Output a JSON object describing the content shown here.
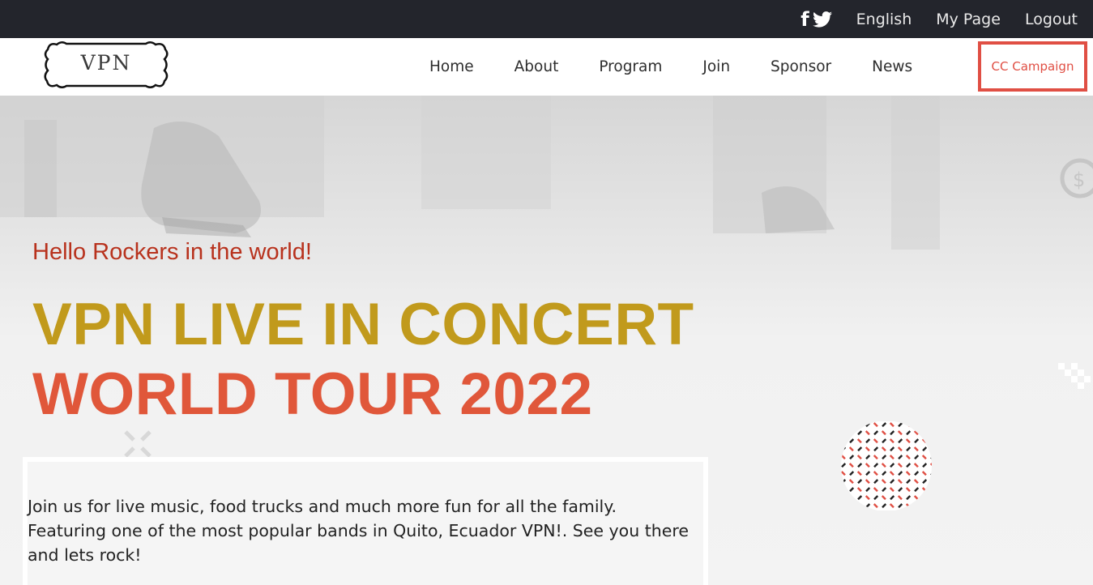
{
  "topbar": {
    "social": {
      "facebook_icon": "f",
      "twitter_icon": "twitter-bird"
    },
    "links": [
      "English",
      "My Page",
      "Logout"
    ]
  },
  "navbar": {
    "logo_text": "VPN",
    "items": [
      "Home",
      "About",
      "Program",
      "Join",
      "Sponsor",
      "News"
    ],
    "campaign_label": "CC Campaign"
  },
  "hero": {
    "greeting": "Hello Rockers in the world!",
    "title_line1": "VPN LIVE IN CONCERT",
    "title_line2": "WORLD TOUR 2022",
    "description": "Join us for live music, food trucks and much more fun for all the family. Featuring one of the most popular bands in Quito, Ecuador VPN!. See you there and lets rock!"
  },
  "colors": {
    "topbar_bg": "#23252c",
    "accent_red": "#e04f44",
    "greeting_red": "#b8321d",
    "title_gold": "#c19a1c",
    "title_orange": "#e0573a"
  }
}
